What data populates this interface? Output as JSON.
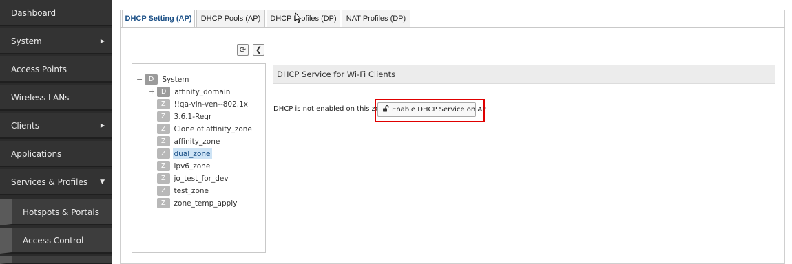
{
  "sidebar": {
    "items": [
      {
        "label": "Dashboard"
      },
      {
        "label": "System",
        "arrow": "▶"
      },
      {
        "label": "Access Points"
      },
      {
        "label": "Wireless LANs"
      },
      {
        "label": "Clients",
        "arrow": "▶"
      },
      {
        "label": "Applications"
      },
      {
        "label": "Services & Profiles",
        "arrow": "▼"
      }
    ],
    "subitems": [
      {
        "label": "Hotspots & Portals"
      },
      {
        "label": "Access Control"
      }
    ]
  },
  "tabs": [
    {
      "label": "DHCP Setting (AP)",
      "active": true
    },
    {
      "label": "DHCP Pools (AP)"
    },
    {
      "label": "DHCP Profiles (DP)"
    },
    {
      "label": "NAT Profiles (DP)"
    }
  ],
  "toolbar": {
    "refresh_icon": "⟳",
    "collapse_icon": "❮"
  },
  "tree": {
    "root": {
      "toggle": "−",
      "badge": "D",
      "label": "System"
    },
    "domain": {
      "toggle": "+",
      "badge": "D",
      "label": "affinity_domain"
    },
    "zones": [
      {
        "badge": "Z",
        "label": "!!qa-vin-ven--802.1x"
      },
      {
        "badge": "Z",
        "label": "3.6.1-Regr"
      },
      {
        "badge": "Z",
        "label": "Clone of affinity_zone"
      },
      {
        "badge": "Z",
        "label": "affinity_zone"
      },
      {
        "badge": "Z",
        "label": "dual_zone",
        "selected": true
      },
      {
        "badge": "Z",
        "label": "ipv6_zone"
      },
      {
        "badge": "Z",
        "label": "jo_test_for_dev"
      },
      {
        "badge": "Z",
        "label": "test_zone"
      },
      {
        "badge": "Z",
        "label": "zone_temp_apply"
      }
    ]
  },
  "section": {
    "title": "DHCP Service for Wi-Fi Clients",
    "status_message": "DHCP is not enabled on this zone.",
    "enable_button": "Enable DHCP Service on AP",
    "lock_icon": "🔓"
  },
  "colors": {
    "sidebar_bg": "#333333",
    "active_tab_text": "#1a4f86",
    "highlight": "#e00000",
    "selected_node": "#cde3f5"
  }
}
